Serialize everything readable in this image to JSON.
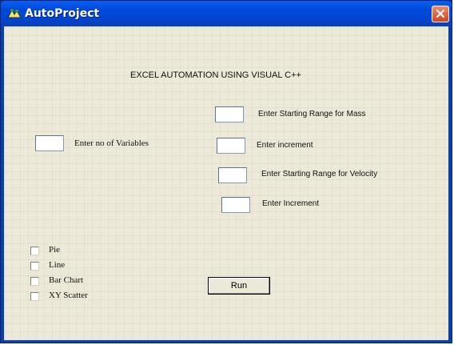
{
  "window": {
    "title": "AutoProject",
    "icon": "app-icon",
    "close_icon": "close-icon",
    "close_color": "#d4441e",
    "titlebar_color": "#0049d8"
  },
  "heading": "EXCEL  AUTOMATION USING VISUAL C++",
  "fields": {
    "variables": {
      "label": "Enter no of Variables",
      "value": ""
    },
    "mass_start": {
      "label": "Enter Starting Range for Mass",
      "value": ""
    },
    "mass_increment": {
      "label": "Enter increment",
      "value": ""
    },
    "velocity_start": {
      "label": "Enter Starting Range for Velocity",
      "value": ""
    },
    "velocity_increment": {
      "label": "Enter Increment",
      "value": ""
    }
  },
  "charts": [
    {
      "label": "Pie",
      "checked": false
    },
    {
      "label": "Line",
      "checked": false
    },
    {
      "label": "Bar Chart",
      "checked": false
    },
    {
      "label": "XY Scatter",
      "checked": false
    }
  ],
  "run_label": "Run"
}
